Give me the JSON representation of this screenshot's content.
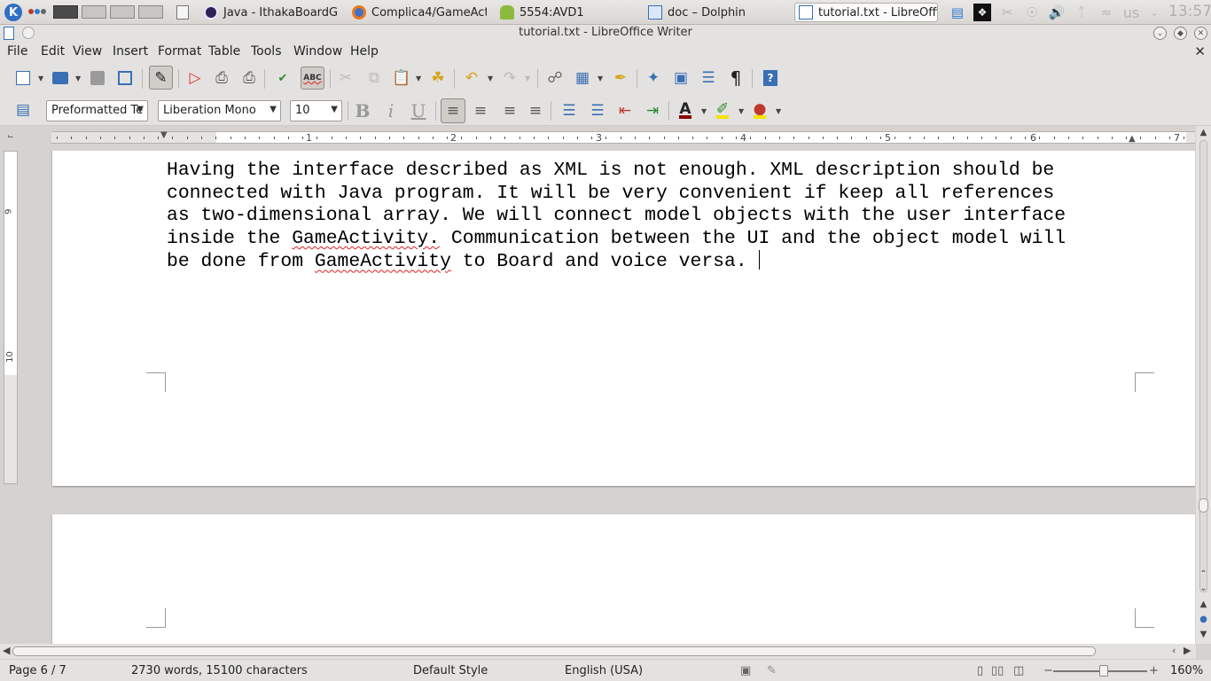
{
  "taskbar": {
    "tasks": [
      {
        "label": "Java - IthakaBoardGam"
      },
      {
        "label": "Complica4/GameActivi"
      },
      {
        "label": "5554:AVD1"
      },
      {
        "label": "doc – Dolphin"
      },
      {
        "label": "tutorial.txt - LibreOffic"
      }
    ],
    "keyboard_layout": "us",
    "clock": "13:57"
  },
  "window": {
    "title": "tutorial.txt - LibreOffice Writer"
  },
  "menu": [
    "File",
    "Edit",
    "View",
    "Insert",
    "Format",
    "Table",
    "Tools",
    "Window",
    "Help"
  ],
  "formatting": {
    "paragraph_style": "Preformatted Te",
    "font_name": "Liberation Mono",
    "font_size": "10"
  },
  "ruler": {
    "numbers": [
      "1",
      "2",
      "3",
      "4",
      "5",
      "6",
      "7"
    ],
    "vertical_numbers": [
      "9",
      "10"
    ]
  },
  "document": {
    "line1": "Having the interface described as XML is not enough. XML description should be",
    "line2": "connected with Java program. It will be very convenient if keep all references",
    "line3": "as two-dimensional array. We will connect model objects with the user interface",
    "line4_pre": "inside the ",
    "line4_misspelled": "GameActivity.",
    "line4_post": " Communication between the UI and the object model will",
    "line5_pre": "be done from ",
    "line5_misspelled": "GameActivity",
    "line5_post": " to Board and voice versa. "
  },
  "status": {
    "page": "Page 6 / 7",
    "words": "2730 words, 15100 characters",
    "page_style": "Default Style",
    "language": "English (USA)",
    "zoom": "160%"
  },
  "colors": {
    "accent": "#3a6fb5",
    "spellcheck": "#e02020"
  }
}
